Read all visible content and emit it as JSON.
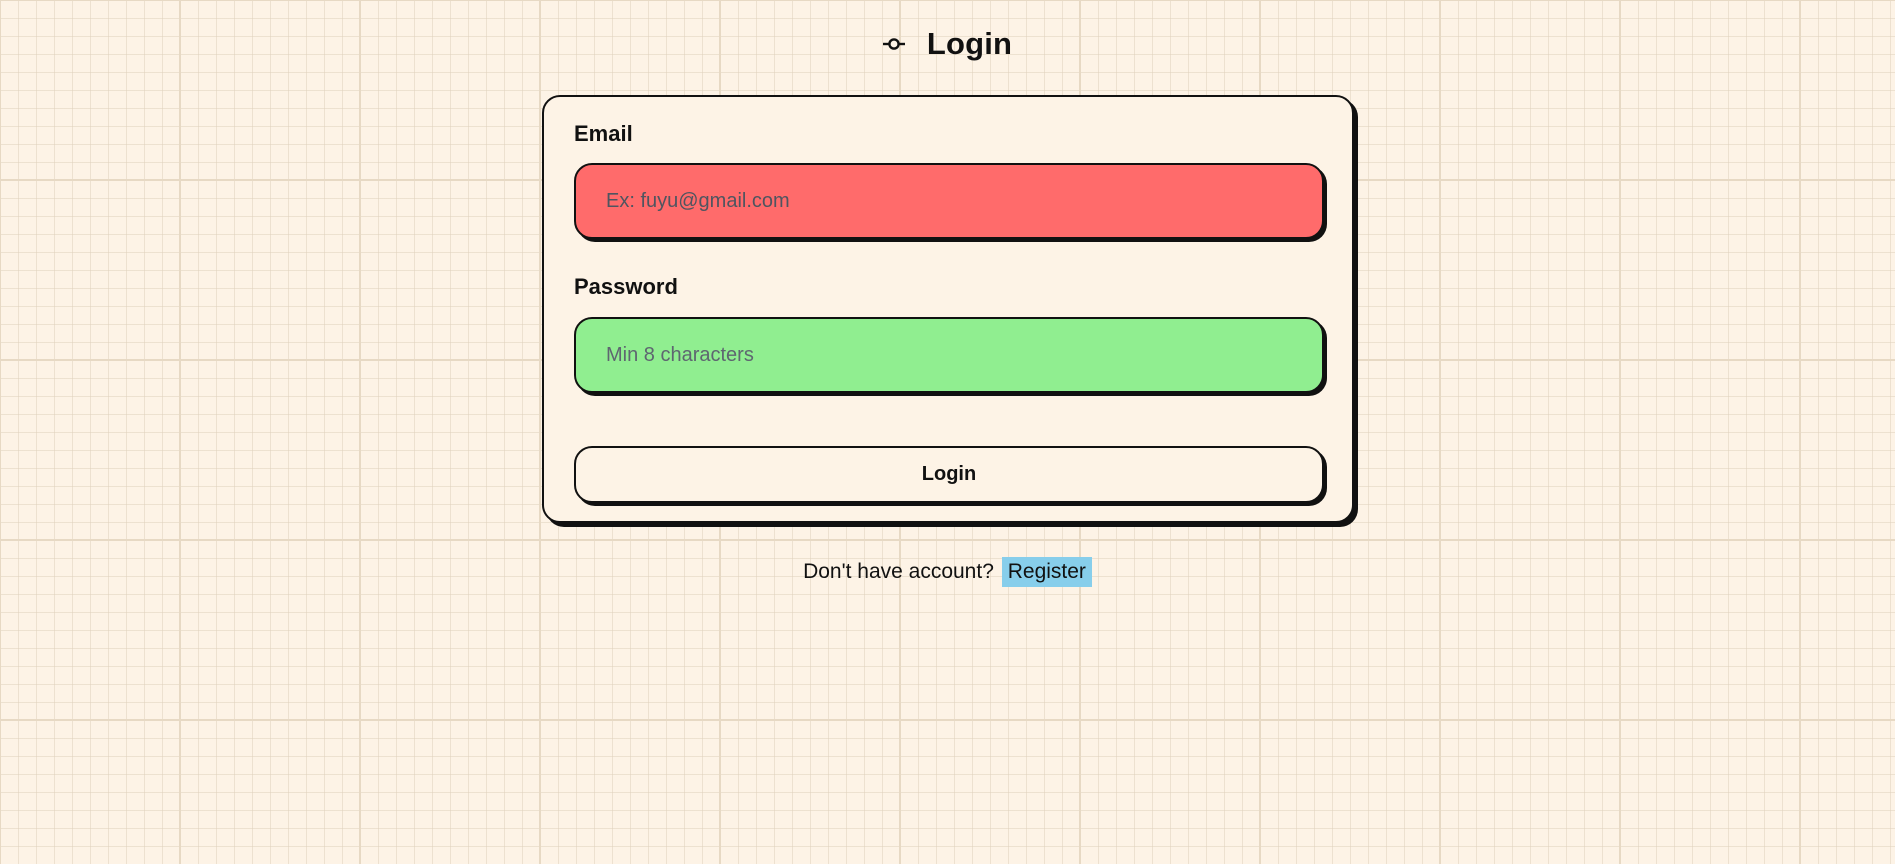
{
  "header": {
    "icon": "commit-icon",
    "title": "Login"
  },
  "form": {
    "email": {
      "label": "Email",
      "value": "",
      "placeholder": "Ex: fuyu@gmail.com",
      "background": "#ff6b6b"
    },
    "password": {
      "label": "Password",
      "value": "",
      "placeholder": "Min 8 characters",
      "background": "#90ee90"
    },
    "submit_label": "Login"
  },
  "footer": {
    "prompt": "Don't have account?",
    "register_label": "Register",
    "register_background": "#87ceeb"
  },
  "colors": {
    "page_background": "#fdf3e6",
    "border": "#111111"
  }
}
